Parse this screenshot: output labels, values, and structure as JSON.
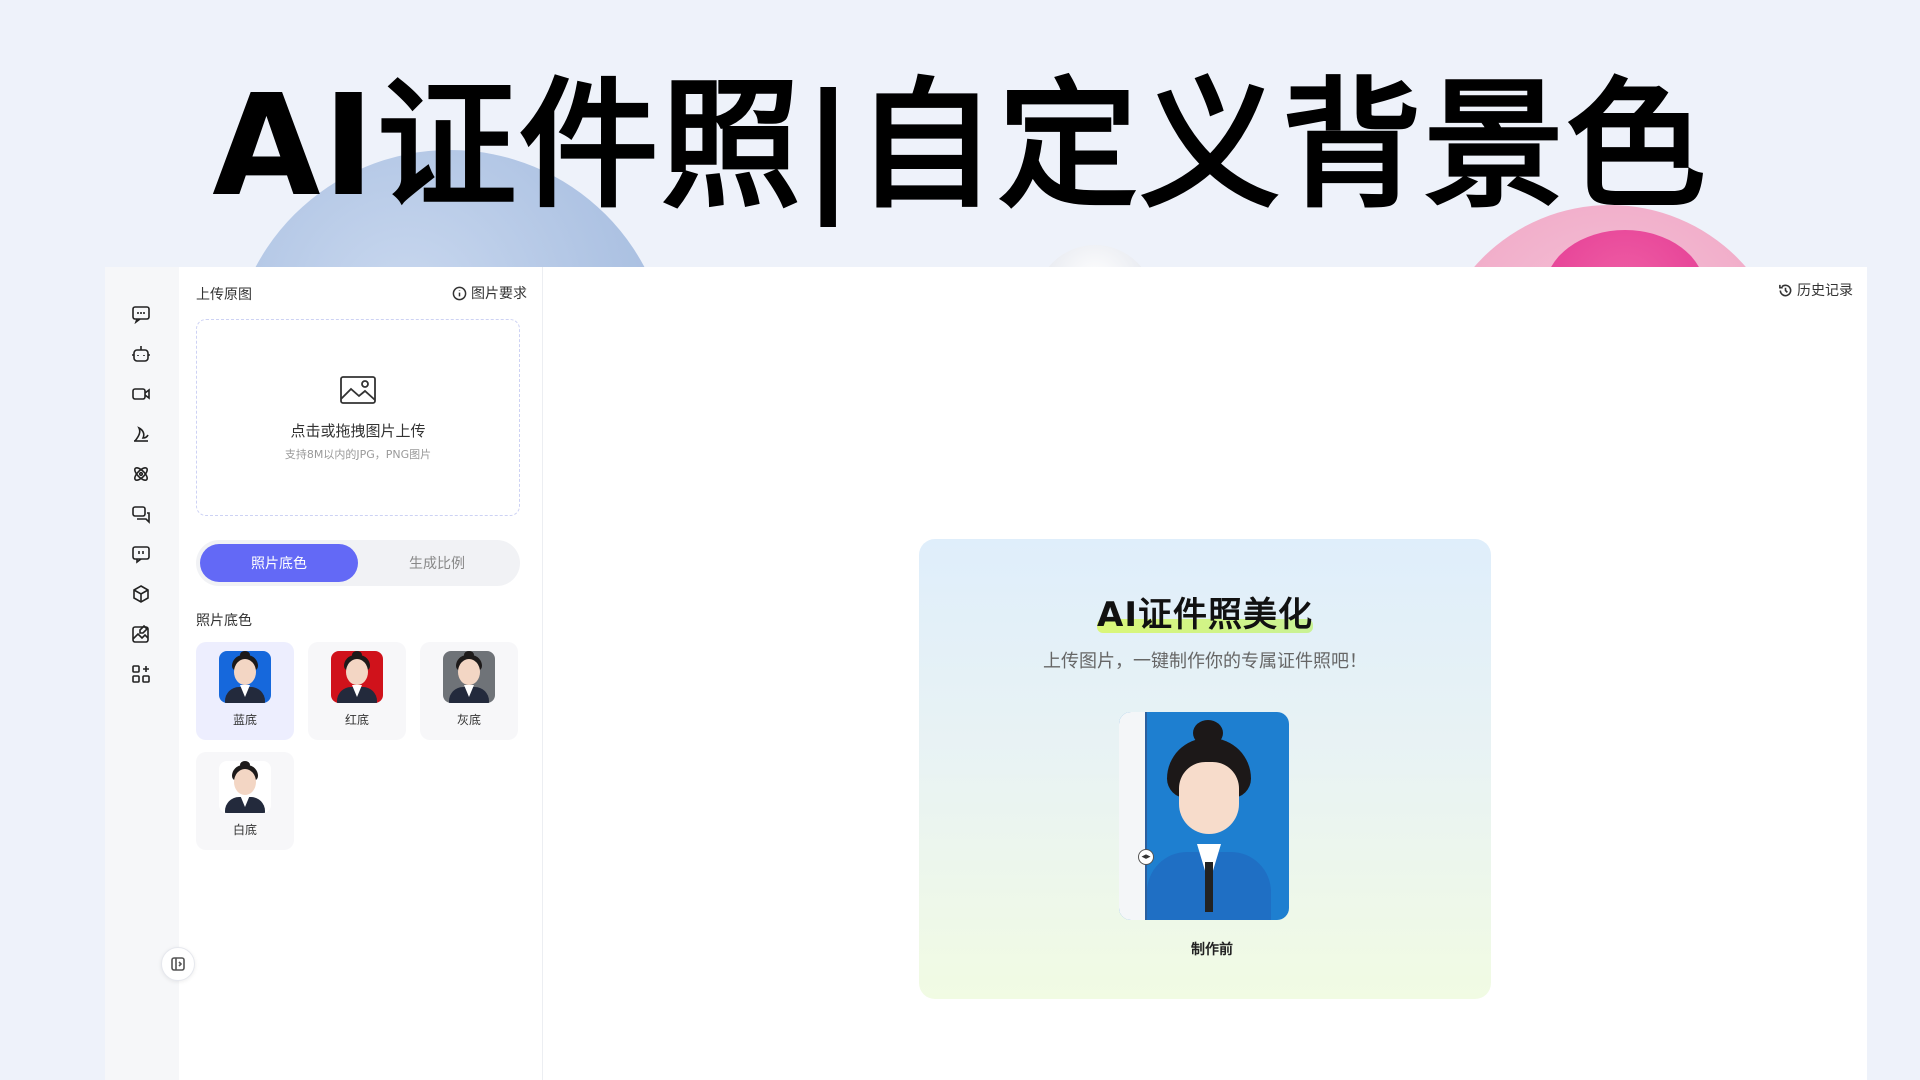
{
  "headline": "AI证件照|自定义背景色",
  "panel": {
    "title": "上传原图",
    "requirements_label": "图片要求",
    "upload": {
      "main_text": "点击或拖拽图片上传",
      "sub_text": "支持8M以内的JPG，PNG图片"
    },
    "tabs": [
      {
        "label": "照片底色",
        "active": true
      },
      {
        "label": "生成比例",
        "active": false
      }
    ],
    "section_label": "照片底色",
    "swatches": [
      {
        "label": "蓝底",
        "color": "#1668dc",
        "selected": true
      },
      {
        "label": "红底",
        "color": "#d0121b",
        "selected": false
      },
      {
        "label": "灰底",
        "color": "#6f7378",
        "selected": false
      },
      {
        "label": "白底",
        "color": "#ffffff",
        "selected": false
      }
    ]
  },
  "rail_icons": [
    "chat-icon",
    "robot-icon",
    "video-icon",
    "draw-icon",
    "atom-icon",
    "comments-icon",
    "message-icon",
    "cube-icon",
    "image-edit-icon",
    "apps-icon"
  ],
  "history_label": "历史记录",
  "preview": {
    "title": "AI证件照美化",
    "subtitle": "上传图片，一键制作你的专属证件照吧！",
    "compare_label": "制作前"
  },
  "colors": {
    "accent": "#6369f6",
    "background": "#eef2fa"
  }
}
